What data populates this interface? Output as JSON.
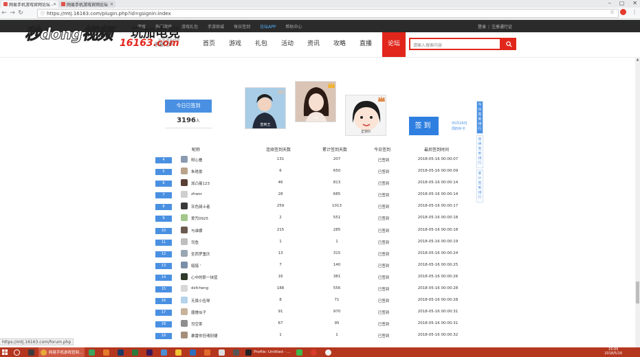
{
  "browser": {
    "tabs": [
      {
        "title": "网易手机游戏官网论坛 -"
      },
      {
        "title": "网易手机游戏官网论坛"
      }
    ],
    "url": "https://mtj.16163.com/plugin.php?id=gsignin:index",
    "status_url": "https://mtj.16163.com/forum.php"
  },
  "topbar": {
    "links": [
      "游戏",
      "热门游戏",
      "游戏礼包",
      "手游商城",
      "每日签到",
      "论坛APP",
      "帮助中心"
    ],
    "login": "登录",
    "register": "注册通行证"
  },
  "watermark": "秒dong视频",
  "logo": {
    "brand": "玩加电竞",
    "domain": "16163.com",
    "tagline": "玩加 我的世界",
    "portal": "手游门户"
  },
  "nav": {
    "items": [
      "首页",
      "游戏",
      "礼包",
      "活动",
      "资讯",
      "攻略",
      "直播"
    ],
    "active": "论坛"
  },
  "search": {
    "placeholder": "请输入搜索内容"
  },
  "today": {
    "label": "今日已签到",
    "count": "3196",
    "unit": "人"
  },
  "podium": [
    {
      "name": "签到王"
    },
    {
      "name": "I.w"
    },
    {
      "name": "正宗D"
    }
  ],
  "sign": {
    "button": "签到",
    "date": "05月16日",
    "streak": "周四补卡"
  },
  "side_tabs": [
    "今日签到排行",
    "连续签到排行",
    "累计签到排行"
  ],
  "table": {
    "headers": [
      "昵称",
      "连续签到天数",
      "累计签到天数",
      "今日签到",
      "最后签到时间"
    ],
    "rows": [
      {
        "rank": "4",
        "name": "呀心叠",
        "continuous": "131",
        "total": "207",
        "today": "已签到",
        "time": "2018-05-16 00:00:07"
      },
      {
        "rank": "5",
        "name": "朱艳景",
        "continuous": "6",
        "total": "650",
        "today": "已签到",
        "time": "2018-05-16 00:00:09"
      },
      {
        "rank": "6",
        "name": "加凸曼123",
        "continuous": "46",
        "total": "813",
        "today": "已签到",
        "time": "2018-05-16 00:00:14"
      },
      {
        "rank": "7",
        "name": "zhwsr",
        "continuous": "28",
        "total": "685",
        "today": "已签到",
        "time": "2018-05-16 00:00:14"
      },
      {
        "rank": "8",
        "name": "灰色骑士者",
        "continuous": "259",
        "total": "1013",
        "today": "已签到",
        "time": "2018-05-16 00:00:17"
      },
      {
        "rank": "9",
        "name": "爱咒0925",
        "continuous": "2",
        "total": "551",
        "today": "已签到",
        "time": "2018-05-16 00:00:18"
      },
      {
        "rank": "10",
        "name": "与谁娜",
        "continuous": "215",
        "total": "285",
        "today": "已签到",
        "time": "2018-05-16 00:00:18"
      },
      {
        "rank": "11",
        "name": "司鱼",
        "continuous": "1",
        "total": "1",
        "today": "已签到",
        "time": "2018-05-16 00:00:19"
      },
      {
        "rank": "12",
        "name": "圣西罗重庆",
        "continuous": "13",
        "total": "315",
        "today": "已签到",
        "time": "2018-05-16 00:00:24"
      },
      {
        "rank": "13",
        "name": "暗猎 '",
        "continuous": "7",
        "total": "140",
        "today": "已签到",
        "time": "2018-05-16 00:00:25"
      },
      {
        "rank": "14",
        "name": "心中的那一抹蓝",
        "continuous": "16",
        "total": "381",
        "today": "已签到",
        "time": "2018-05-16 00:00:26"
      },
      {
        "rank": "15",
        "name": "dsfcheng",
        "continuous": "188",
        "total": "556",
        "today": "已签到",
        "time": "2018-05-16 00:00:28"
      },
      {
        "rank": "16",
        "name": "无畏小伍琴",
        "continuous": "8",
        "total": "71",
        "today": "已签到",
        "time": "2018-05-16 00:00:28"
      },
      {
        "rank": "17",
        "name": "唐僧似子",
        "continuous": "91",
        "total": "970",
        "today": "已签到",
        "time": "2018-05-16 00:00:31"
      },
      {
        "rank": "18",
        "name": "司空茶",
        "continuous": "67",
        "total": "95",
        "today": "已签到",
        "time": "2018-05-16 00:00:31"
      },
      {
        "rank": "19",
        "name": "暴雷你狂魂别捷",
        "continuous": "1",
        "total": "1",
        "today": "已签到",
        "time": "2018-05-16 00:00:32"
      }
    ]
  },
  "taskbar": {
    "tasks": [
      "网易手机游戏官网...",
      "Profile: Untitled - ..."
    ],
    "time": "15:05",
    "date": "2018/5/16"
  },
  "colors": {
    "accent": "#e1261c",
    "blue": "#4a90e2",
    "topbar": "#2b2b2b",
    "taskbar": "#b5361f"
  }
}
